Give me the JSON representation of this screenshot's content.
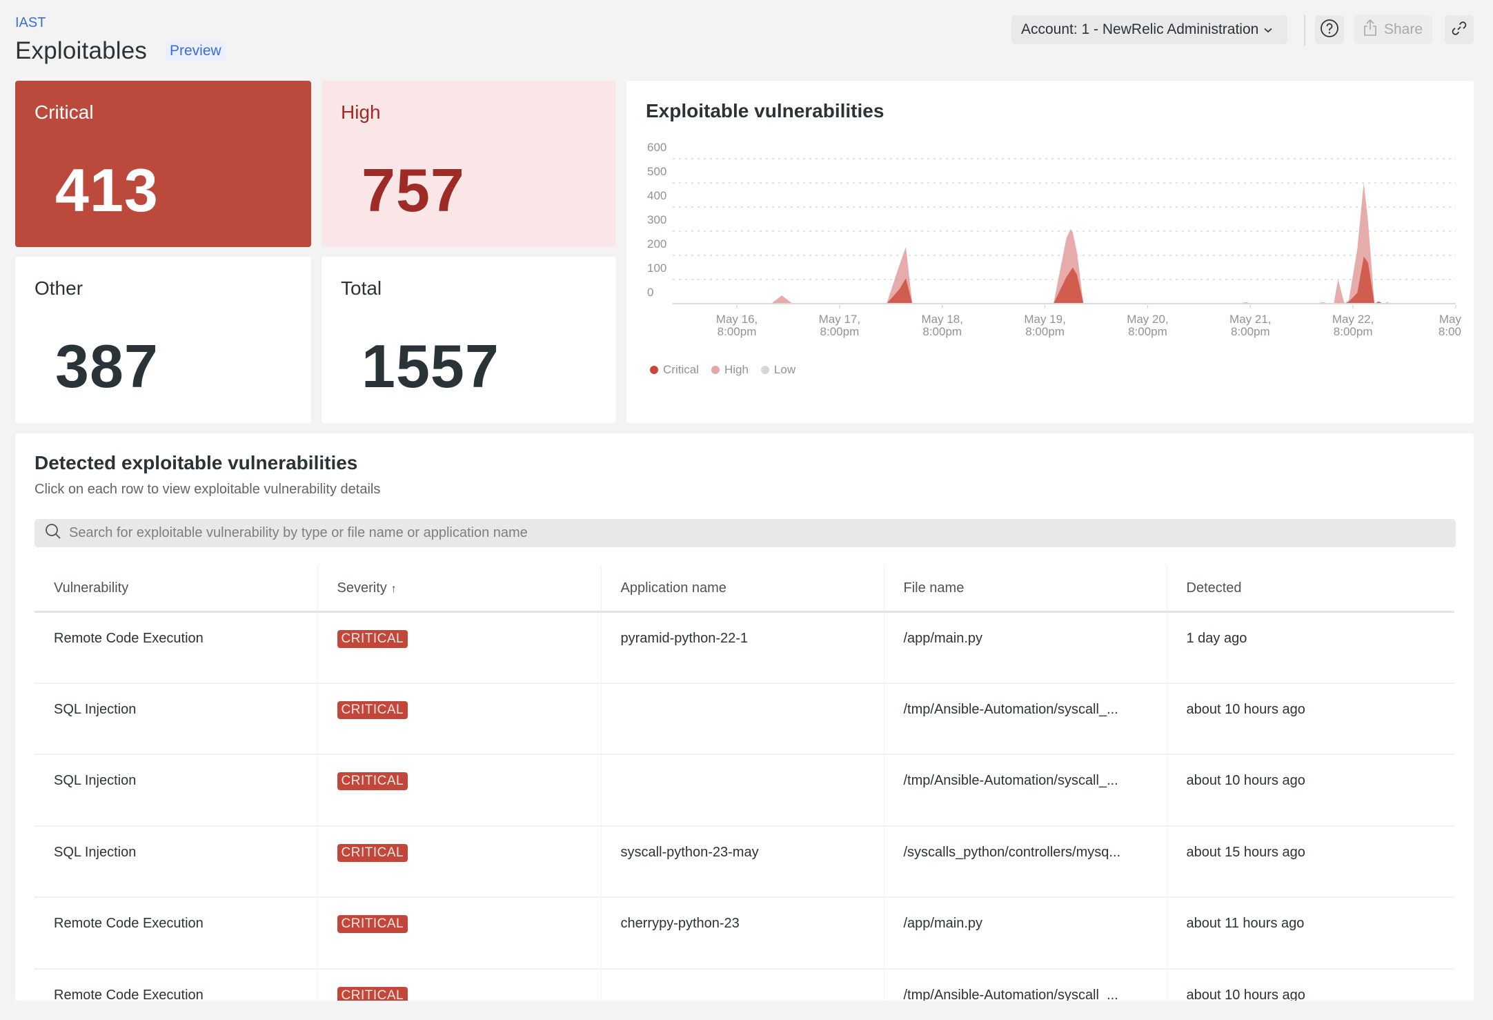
{
  "header": {
    "breadcrumb": "IAST",
    "title": "Exploitables",
    "preview_badge": "Preview",
    "account_label": "Account: 1 - NewRelic Administration",
    "share_label": "Share",
    "icons": {
      "help": "help-circle-icon",
      "share": "share-icon",
      "link": "link-icon",
      "account_dropdown": "chevron-down-icon"
    }
  },
  "billboards": [
    {
      "label": "Critical",
      "value": "413"
    },
    {
      "label": "High",
      "value": "757"
    },
    {
      "label": "Other",
      "value": "387"
    },
    {
      "label": "Total",
      "value": "1557"
    }
  ],
  "colors": {
    "critical": "#bb4a3d",
    "critical_area": "#d0584c",
    "high_area": "#e5a8a6",
    "high_card_bg": "#fae6e6",
    "high_text": "#9e2b25",
    "low": "#d6d6d6",
    "link_blue": "#3b6fd8"
  },
  "chart_data": {
    "type": "area",
    "title": "Exploitable vulnerabilities",
    "xlabel": "",
    "ylabel": "",
    "ylim": [
      0,
      600
    ],
    "yticks": [
      0,
      100,
      200,
      300,
      400,
      500,
      600
    ],
    "grid": true,
    "legend_position": "bottom-left",
    "x_unit": "hours since May 16, 8:00pm",
    "xlim": [
      -15,
      168
    ],
    "xticks": [
      {
        "x": 0,
        "label": [
          "May 16,",
          "8:00pm"
        ]
      },
      {
        "x": 24,
        "label": [
          "May 17,",
          "8:00pm"
        ]
      },
      {
        "x": 48,
        "label": [
          "May 18,",
          "8:00pm"
        ]
      },
      {
        "x": 72,
        "label": [
          "May 19,",
          "8:00pm"
        ]
      },
      {
        "x": 96,
        "label": [
          "May 20,",
          "8:00pm"
        ]
      },
      {
        "x": 120,
        "label": [
          "May 21,",
          "8:00pm"
        ]
      },
      {
        "x": 144,
        "label": [
          "May 22,",
          "8:00pm"
        ]
      },
      {
        "x": 168,
        "label": [
          "May",
          "8:00"
        ]
      }
    ],
    "stacked": true,
    "series": [
      {
        "name": "Critical",
        "color": "#d0584c",
        "points": [
          [
            -15,
            0
          ],
          [
            8,
            0
          ],
          [
            10.5,
            3
          ],
          [
            13,
            0
          ],
          [
            35,
            0
          ],
          [
            38,
            60
          ],
          [
            39.5,
            105
          ],
          [
            41,
            0
          ],
          [
            74,
            0
          ],
          [
            77,
            110
          ],
          [
            78.5,
            150
          ],
          [
            79.5,
            120
          ],
          [
            81,
            0
          ],
          [
            117,
            0
          ],
          [
            119,
            3
          ],
          [
            120.5,
            0
          ],
          [
            135,
            0
          ],
          [
            137,
            3
          ],
          [
            138.5,
            0
          ],
          [
            139.5,
            0
          ],
          [
            140.5,
            4
          ],
          [
            142,
            0
          ],
          [
            143,
            8
          ],
          [
            145,
            45
          ],
          [
            146.5,
            195
          ],
          [
            147.5,
            170
          ],
          [
            149,
            0
          ],
          [
            150,
            8
          ],
          [
            151,
            0
          ],
          [
            152,
            3
          ],
          [
            153,
            0
          ],
          [
            168,
            0
          ]
        ]
      },
      {
        "name": "High",
        "color": "#e5a8a6",
        "points": [
          [
            -15,
            0
          ],
          [
            8,
            0
          ],
          [
            10.5,
            31
          ],
          [
            13,
            0
          ],
          [
            35,
            0
          ],
          [
            38,
            100
          ],
          [
            39.5,
            130
          ],
          [
            41,
            0
          ],
          [
            74,
            0
          ],
          [
            77,
            160
          ],
          [
            78,
            172
          ],
          [
            79.5,
            90
          ],
          [
            81,
            0
          ],
          [
            114,
            0
          ],
          [
            115,
            3
          ],
          [
            116,
            0
          ],
          [
            117,
            0
          ],
          [
            119,
            3
          ],
          [
            120.5,
            0
          ],
          [
            130,
            0
          ],
          [
            131,
            3
          ],
          [
            132,
            0
          ],
          [
            135,
            0
          ],
          [
            137,
            3
          ],
          [
            138.5,
            0
          ],
          [
            139.5,
            0
          ],
          [
            140.5,
            96
          ],
          [
            142,
            0
          ],
          [
            143,
            5
          ],
          [
            145,
            180
          ],
          [
            146.5,
            305
          ],
          [
            147.5,
            170
          ],
          [
            149,
            0
          ],
          [
            150,
            3
          ],
          [
            151,
            0
          ],
          [
            152,
            3
          ],
          [
            153,
            0
          ],
          [
            168,
            0
          ]
        ]
      },
      {
        "name": "Low",
        "color": "#d6d6d6",
        "points": [
          [
            -15,
            0
          ],
          [
            168,
            0
          ]
        ]
      }
    ]
  },
  "table": {
    "title": "Detected exploitable vulnerabilities",
    "subtitle": "Click on each row to view exploitable vulnerability details",
    "search_placeholder": "Search for exploitable vulnerability by type or file name or application name",
    "search_value": "",
    "columns": [
      "Vulnerability",
      "Severity",
      "Application name",
      "File name",
      "Detected"
    ],
    "sort": {
      "column": "Severity",
      "direction_icon": "↑"
    },
    "rows": [
      {
        "vulnerability": "Remote Code Execution",
        "severity": "CRITICAL",
        "application": "pyramid-python-22-1",
        "file": "/app/main.py",
        "detected": "1 day ago"
      },
      {
        "vulnerability": "SQL Injection",
        "severity": "CRITICAL",
        "application": "",
        "file": "/tmp/Ansible-Automation/syscall_...",
        "detected": "about 10 hours ago"
      },
      {
        "vulnerability": "SQL Injection",
        "severity": "CRITICAL",
        "application": "",
        "file": "/tmp/Ansible-Automation/syscall_...",
        "detected": "about 10 hours ago"
      },
      {
        "vulnerability": "SQL Injection",
        "severity": "CRITICAL",
        "application": "syscall-python-23-may",
        "file": "/syscalls_python/controllers/mysq...",
        "detected": "about 15 hours ago"
      },
      {
        "vulnerability": "Remote Code Execution",
        "severity": "CRITICAL",
        "application": "cherrypy-python-23",
        "file": "/app/main.py",
        "detected": "about 11 hours ago"
      },
      {
        "vulnerability": "Remote Code Execution",
        "severity": "CRITICAL",
        "application": "",
        "file": "/tmp/Ansible-Automation/syscall_...",
        "detected": "about 10 hours ago"
      }
    ]
  }
}
